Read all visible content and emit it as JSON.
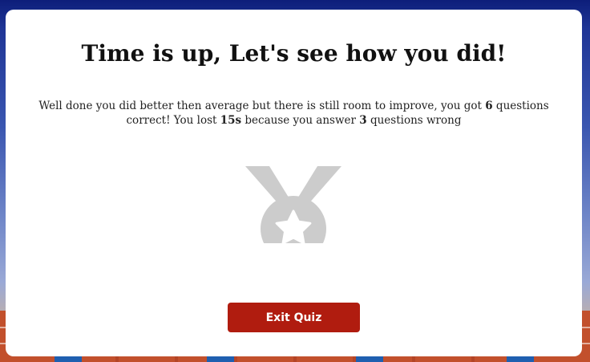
{
  "results": {
    "title": "Time is up, Let's see how you did!",
    "message": {
      "part1": "Well done you did better then average but there is still room to improve, you got ",
      "correct_count": "6",
      "part2": " questions correct! You lost ",
      "lost_time": "15s",
      "part3": " because you answer ",
      "wrong_count": "3",
      "part4": " questions wrong"
    },
    "medal_icon": "medal-star-icon",
    "exit_button_label": "Exit Quiz"
  },
  "colors": {
    "button": "#b01c0f",
    "medal": "#cccccc"
  }
}
